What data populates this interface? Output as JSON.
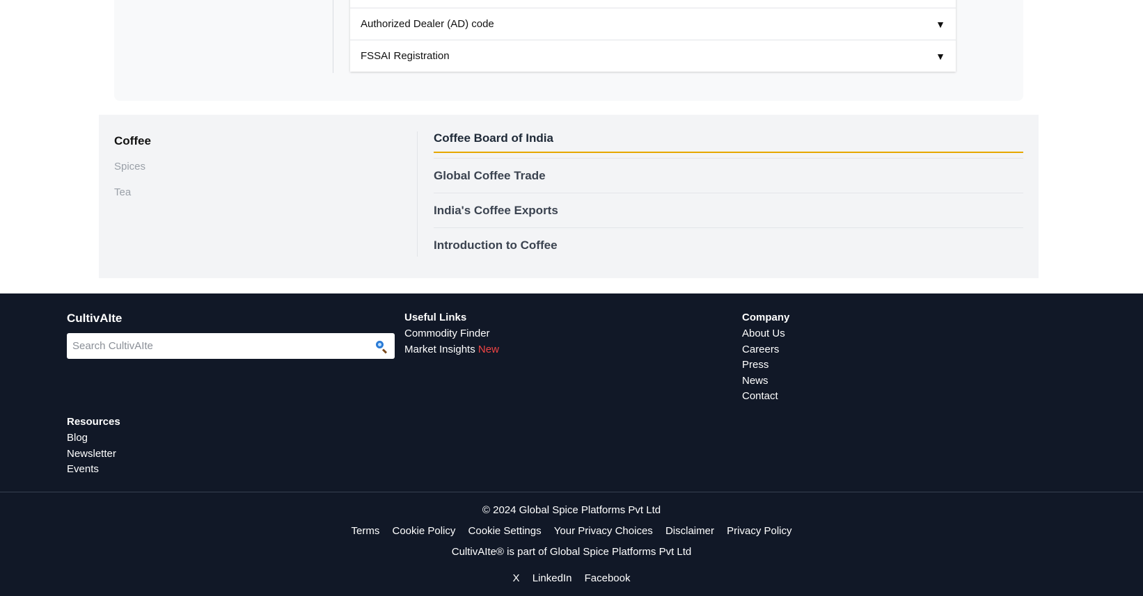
{
  "accordion": {
    "items": [
      {
        "label": "Authorized Dealer (AD) code"
      },
      {
        "label": "FSSAI Registration"
      }
    ]
  },
  "commodity_nav": {
    "categories": [
      {
        "label": "Coffee",
        "active": true
      },
      {
        "label": "Spices",
        "active": false
      },
      {
        "label": "Tea",
        "active": false
      }
    ],
    "heading": "Coffee Board of India",
    "links": [
      "Global Coffee Trade",
      "India's Coffee Exports",
      "Introduction to Coffee"
    ]
  },
  "footer": {
    "brand": "CultivAIte",
    "search": {
      "placeholder": "Search CultivAIte"
    },
    "useful_links": {
      "title": "Useful Links",
      "items": [
        "Commodity Finder",
        "Market Insights"
      ],
      "new_badge": "New"
    },
    "company": {
      "title": "Company",
      "items": [
        "About Us",
        "Careers",
        "Press",
        "News",
        "Contact"
      ]
    },
    "resources": {
      "title": "Resources",
      "items": [
        "Blog",
        "Newsletter",
        "Events"
      ]
    },
    "copyright": "© 2024 Global Spice Platforms Pvt Ltd",
    "legal_links": [
      "Terms",
      "Cookie Policy",
      "Cookie Settings",
      "Your Privacy Choices",
      "Disclaimer",
      "Privacy Policy"
    ],
    "tagline": "CultivAIte® is part of Global Spice Platforms Pvt Ltd",
    "social": [
      "X",
      "LinkedIn",
      "Facebook"
    ]
  },
  "colors": {
    "footer_bg": "#111827",
    "accent_underline": "#e6a800",
    "new_badge": "#ef4444"
  }
}
